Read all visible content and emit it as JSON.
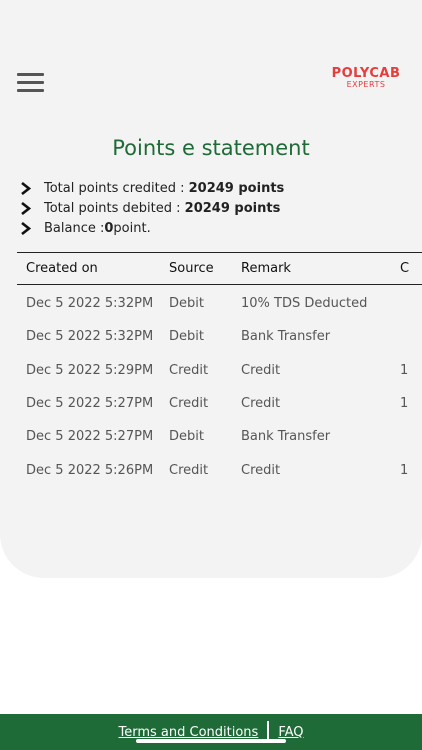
{
  "header": {
    "logo_main": "POLYCAB",
    "logo_sub": "EXPERTS",
    "menu_icon": "hamburger-icon"
  },
  "page_title": "Points e statement",
  "summary": {
    "credited_label": "Total points credited : ",
    "credited_value": "20249 points",
    "debited_label": "Total points debited : ",
    "debited_value": "20249 points",
    "balance_label": "Balance : ",
    "balance_value": "0",
    "balance_suffix": " point."
  },
  "table": {
    "columns": [
      "Created on",
      "Source",
      "Remark",
      "C"
    ],
    "rows": [
      {
        "created_on": "Dec 5 2022 5:32PM",
        "source": "Debit",
        "remark": "10% TDS Deducted",
        "extra": ""
      },
      {
        "created_on": "Dec 5 2022 5:32PM",
        "source": "Debit",
        "remark": "Bank Transfer",
        "extra": ""
      },
      {
        "created_on": "Dec 5 2022 5:29PM",
        "source": "Credit",
        "remark": "Credit",
        "extra": "1"
      },
      {
        "created_on": "Dec 5 2022 5:27PM",
        "source": "Credit",
        "remark": "Credit",
        "extra": "1"
      },
      {
        "created_on": "Dec 5 2022 5:27PM",
        "source": "Debit",
        "remark": "Bank Transfer",
        "extra": ""
      },
      {
        "created_on": "Dec 5 2022 5:26PM",
        "source": "Credit",
        "remark": "Credit",
        "extra": "1"
      }
    ]
  },
  "footer": {
    "terms_label": "Terms and Conditions",
    "faq_label": "FAQ"
  },
  "colors": {
    "brand_green": "#1f6b38",
    "logo_red": "#e63c3c",
    "card_bg": "#f3f3f3"
  }
}
